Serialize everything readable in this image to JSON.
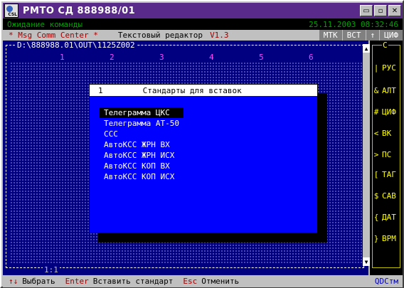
{
  "window": {
    "title": "РМТО СД 888988/01",
    "buttons": [
      "▭",
      "▫",
      "✕"
    ]
  },
  "status": {
    "left": "Ожидание команды",
    "right": "25.11.2003 08:32:46"
  },
  "menu": {
    "msg": "* Msg Comm Center *",
    "editor": "Текстовый редактор",
    "version": "V1.3",
    "flags": [
      "МТК",
      "ВСТ",
      "↑",
      "ЦИФ"
    ]
  },
  "editor": {
    "path": "D:\\888988.01\\OUT\\1125Z002",
    "ruler": [
      "1",
      "2",
      "3",
      "4",
      "5",
      "6"
    ],
    "position": "1:1"
  },
  "right_panel": {
    "title": "С",
    "items": [
      {
        "key": "|",
        "label": "РУС"
      },
      {
        "key": "&",
        "label": "АЛТ"
      },
      {
        "key": "#",
        "label": "ЦИФ"
      },
      {
        "key": "<",
        "label": "ВК"
      },
      {
        "key": ">",
        "label": "ПС"
      },
      {
        "key": "[",
        "label": "ТАГ"
      },
      {
        "key": "$",
        "label": "САВ"
      },
      {
        "key": "{",
        "label": "ДАТ"
      },
      {
        "key": "}",
        "label": "ВРМ"
      }
    ]
  },
  "dialog": {
    "number": "1",
    "title": "Стандарты для вставок",
    "items": [
      "Телеграмма ЦКС",
      "Телеграмма АТ-50",
      "ССС",
      "АвтоКСС ЖРН ВХ",
      "АвтоКСС ЖРН ИСХ",
      "АвтоКСС КОП ВХ",
      "АвтоКСС КОП ИСХ"
    ],
    "selected_index": 0
  },
  "hints": [
    {
      "key": "↑↓",
      "desc": "Выбрать"
    },
    {
      "key": "Enter",
      "desc": "Вставить стандарт"
    },
    {
      "key": "Esc",
      "desc": "Отменить"
    }
  ],
  "brand": "QDCтм",
  "colors": {
    "titlebar": "#5a2a8a",
    "editor_bg": "#000080",
    "dialog_bg": "#0000ff",
    "status_text": "#00a000",
    "panel_text": "#ffff00",
    "ruler_text": "#ff40ff"
  }
}
